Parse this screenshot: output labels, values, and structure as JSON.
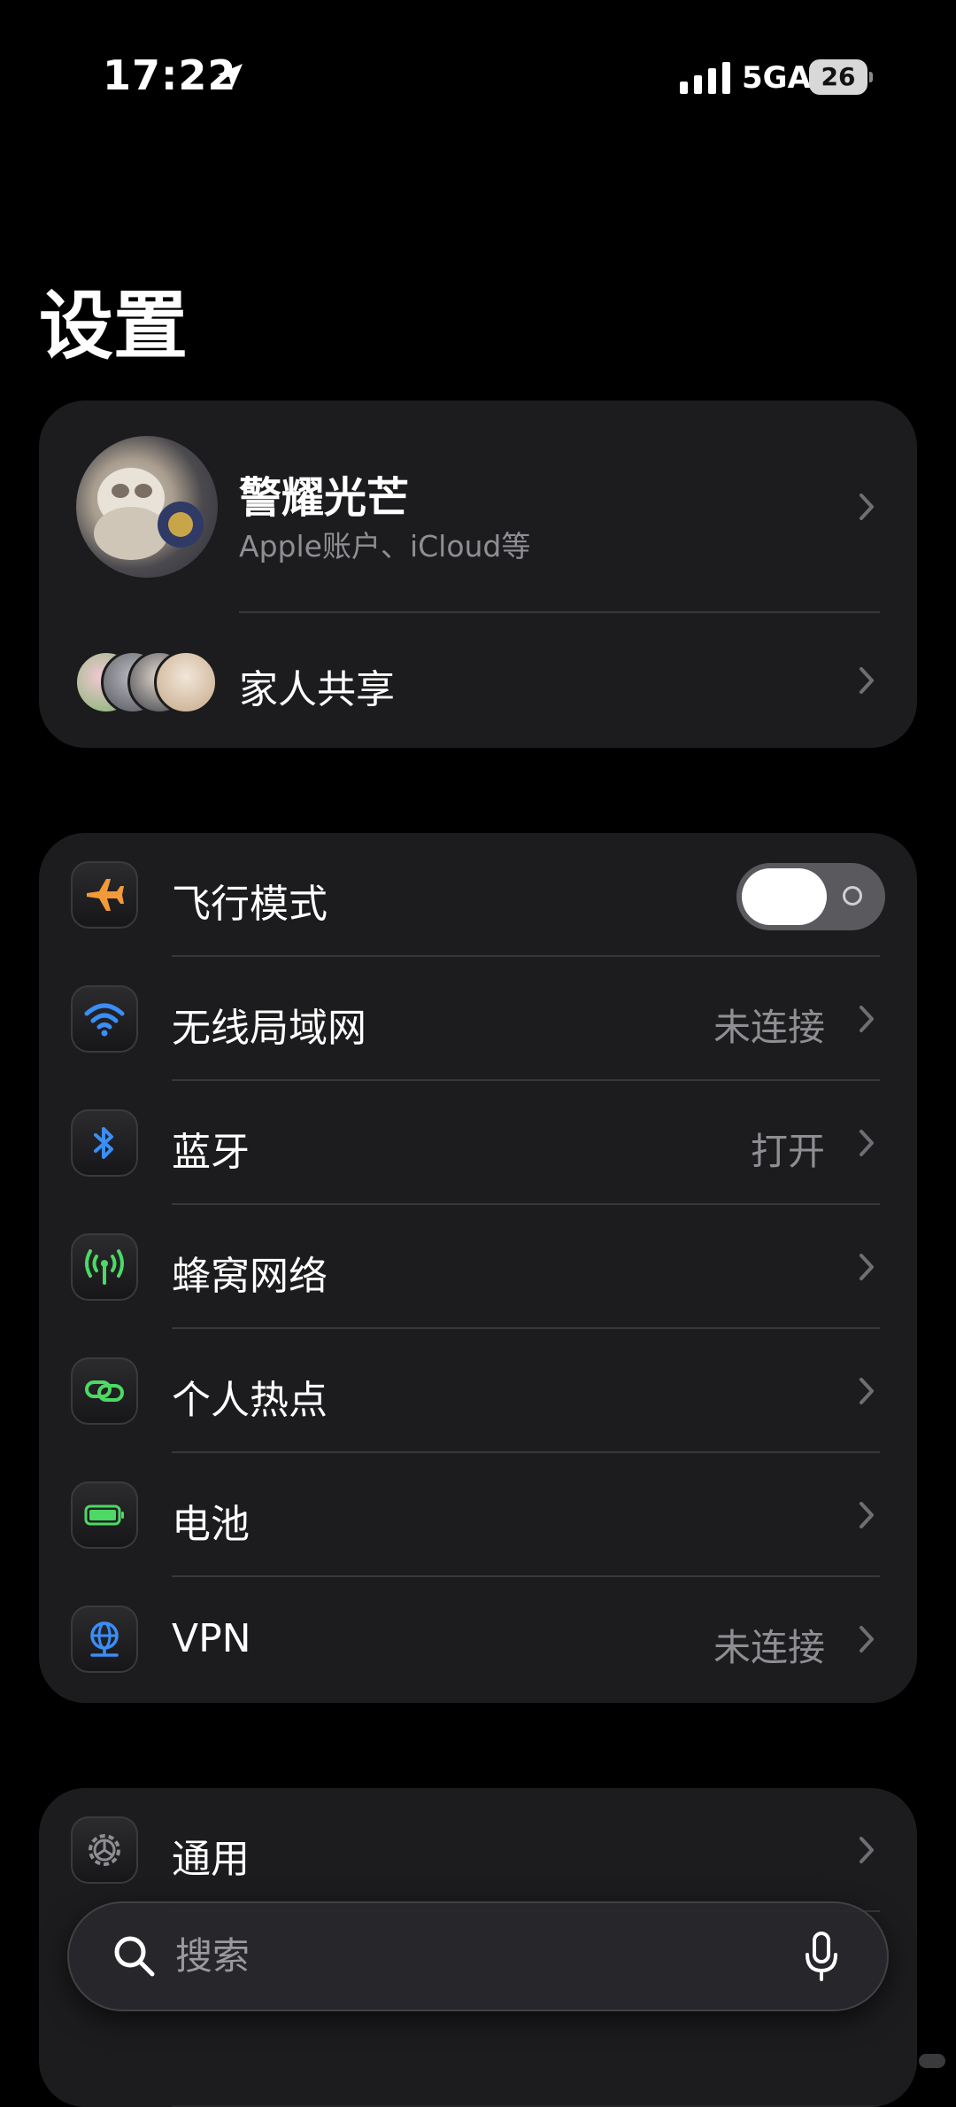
{
  "status_bar": {
    "time": "17:22",
    "network": "5GA",
    "battery": "26"
  },
  "page": {
    "title": "设置"
  },
  "profile": {
    "name": "警耀光芒",
    "subtitle": "Apple账户、iCloud等",
    "family_label": "家人共享"
  },
  "connectivity": {
    "airplane": {
      "label": "飞行模式",
      "enabled": false
    },
    "wifi": {
      "label": "无线局域网",
      "value": "未连接"
    },
    "bluetooth": {
      "label": "蓝牙",
      "value": "打开"
    },
    "cellular": {
      "label": "蜂窝网络"
    },
    "hotspot": {
      "label": "个人热点"
    },
    "battery": {
      "label": "电池"
    },
    "vpn": {
      "label": "VPN",
      "value": "未连接"
    }
  },
  "general": {
    "general_label": "通用"
  },
  "search": {
    "placeholder": "搜索"
  },
  "colors": {
    "airplane": "#f29a38",
    "wifi": "#3a8ef6",
    "bluetooth": "#3a8ef6",
    "cellular": "#4cd964",
    "hotspot": "#4cd964",
    "battery": "#4cd964",
    "vpn": "#3a8ef6"
  }
}
